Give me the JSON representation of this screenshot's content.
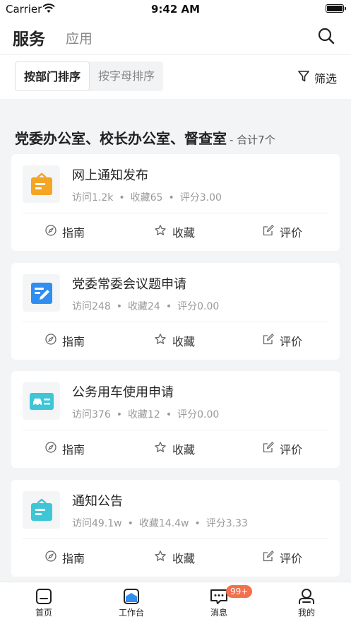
{
  "status_bar": {
    "carrier": "Carrier",
    "time": "9:42 AM"
  },
  "header": {
    "tab_active": "服务",
    "tab_other": "应用"
  },
  "sort": {
    "by_department": "按部门排序",
    "by_letter": "按字母排序",
    "filter_label": "筛选"
  },
  "section": {
    "title": "党委办公室、校长办公室、督查室",
    "count": "- 合计7个"
  },
  "cards": [
    {
      "title": "网上通知发布",
      "visits": "访问1.2k",
      "favorites": "收藏65",
      "rating": "评分3.00",
      "icon": "notice-board-icon",
      "icon_color": "#f5a524"
    },
    {
      "title": "党委常委会议题申请",
      "visits": "访问248",
      "favorites": "收藏24",
      "rating": "评分0.00",
      "icon": "edit-document-icon",
      "icon_color": "#2f8ef0"
    },
    {
      "title": "公务用车使用申请",
      "visits": "访问376",
      "favorites": "收藏12",
      "rating": "评分0.00",
      "icon": "car-icon",
      "icon_color": "#3ec6d6"
    },
    {
      "title": "通知公告",
      "visits": "访问49.1w",
      "favorites": "收藏14.4w",
      "rating": "评分3.33",
      "icon": "notice-board-icon",
      "icon_color": "#3ec6d6"
    }
  ],
  "actions": {
    "guide": "指南",
    "favorite": "收藏",
    "review": "评价"
  },
  "tabbar": {
    "home": "首页",
    "workbench": "工作台",
    "messages": "消息",
    "messages_badge": "99+",
    "mine": "我的"
  },
  "colors": {
    "accent_blue": "#2f8ef0",
    "badge": "#f2704d"
  }
}
